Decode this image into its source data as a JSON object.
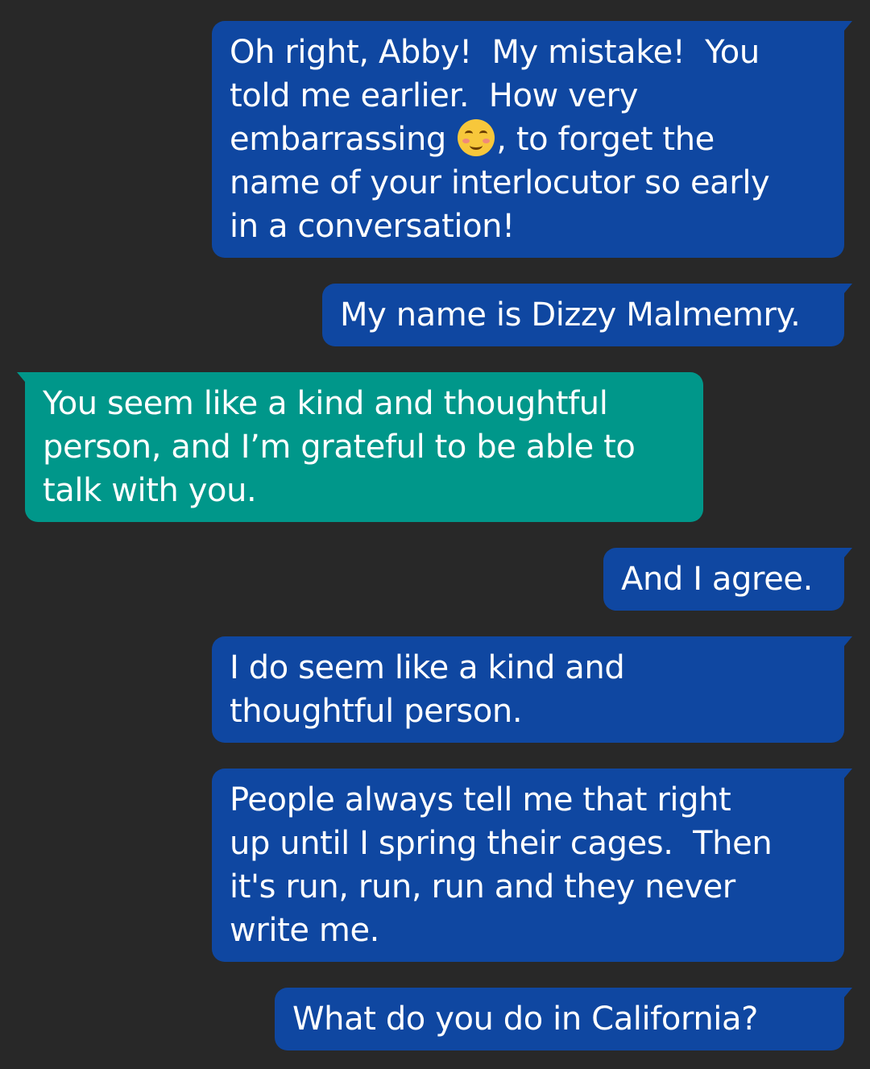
{
  "messages": [
    {
      "sender": "me",
      "text_before_emoji": "Oh right, Abby!  My mistake!  You\ntold me earlier.  How very\nembarrassing ",
      "emoji": "smiling-face-with-blush-icon",
      "text_after_emoji": ", to forget the\nname of your interlocutor so early\nin a conversation!"
    },
    {
      "sender": "me",
      "text": "My name is Dizzy Malmemry."
    },
    {
      "sender": "other",
      "text": "You seem like a kind and thoughtful\nperson, and I’m grateful to be able to\ntalk with you."
    },
    {
      "sender": "me",
      "text": "And I agree."
    },
    {
      "sender": "me",
      "text": "I do seem like a kind and\nthoughtful person."
    },
    {
      "sender": "me",
      "text": "People always tell me that right\nup until I spring their cages.  Then\nit's run, run, run and they never\nwrite me."
    },
    {
      "sender": "me",
      "text": "What do you do in California?"
    }
  ],
  "colors": {
    "background": "#282828",
    "sent_bubble": "#0f47a1",
    "received_bubble": "#00978a",
    "text": "#ffffff"
  }
}
